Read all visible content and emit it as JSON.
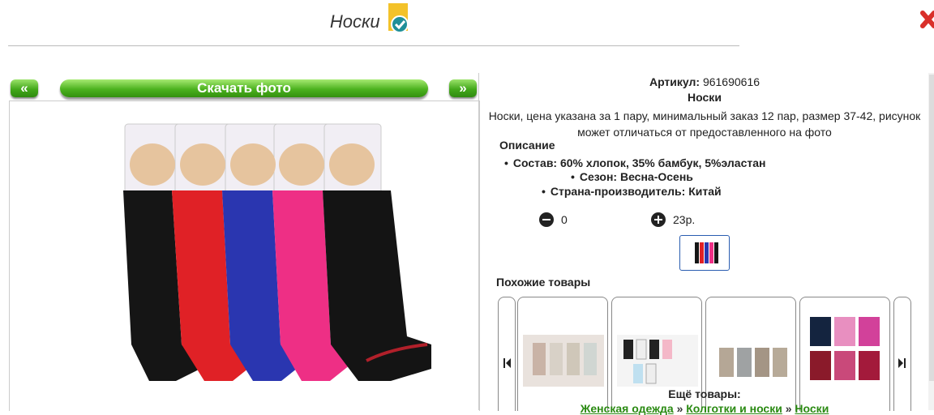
{
  "page": {
    "title": "Носки"
  },
  "gallery": {
    "prev_label": "«",
    "next_label": "»",
    "download_label": "Скачать фото"
  },
  "product": {
    "sku_label": "Артикул:",
    "sku_value": "961690616",
    "name": "Носки",
    "description": "Носки, цена указана за 1 пару, минимальный заказ 12 пар, размер 37-42, рисунок может отличаться от предоставленного на фото",
    "desc_heading": "Описание",
    "specs": [
      "Состав: 60% хлопок, 35% бамбук, 5%эластан",
      "Сезон: Весна-Осень",
      "Страна-производитель: Китай"
    ],
    "quantity": "0",
    "price": "23р."
  },
  "similar": {
    "heading": "Похожие товары",
    "items_count": 4
  },
  "more": {
    "heading": "Ещё товары:",
    "crumbs": [
      "Женская одежда",
      "Колготки и носки",
      "Носки"
    ],
    "separator": "»"
  },
  "colors": {
    "accent_green": "#43a81b",
    "link_green": "#2a8a12",
    "thumb_border": "#2a5db0",
    "close_red": "#d9302a"
  }
}
